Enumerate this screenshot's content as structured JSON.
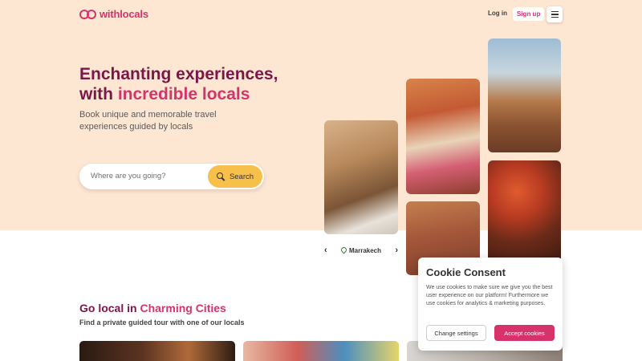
{
  "header": {
    "logo_text": "withlocals",
    "login_label": "Log in",
    "signup_label": "Sign up"
  },
  "hero": {
    "title_line1": "Enchanting experiences,",
    "title_line2_prefix": "with ",
    "title_line2_accent": "incredible locals",
    "subtitle": "Book unique and memorable travel experiences guided by locals",
    "search_placeholder": "Where are you going?",
    "search_button": "Search",
    "carousel_location": "Marrakech"
  },
  "section": {
    "title_prefix": "Go local in ",
    "title_accent": "Charming Cities",
    "subtitle": "Find a private guided tour with one of our locals"
  },
  "cookie": {
    "title": "Cookie Consent",
    "text": "We use cookies to make sure we give you the best user experience on our platform! Furthermore we use cookies for analytics & marketing purposes.",
    "settings_label": "Change settings",
    "accept_label": "Accept cookies"
  },
  "colors": {
    "brand": "#d6336c",
    "title": "#7a1748",
    "hero_bg": "#fde6d2",
    "search_button": "#f7c04a"
  }
}
